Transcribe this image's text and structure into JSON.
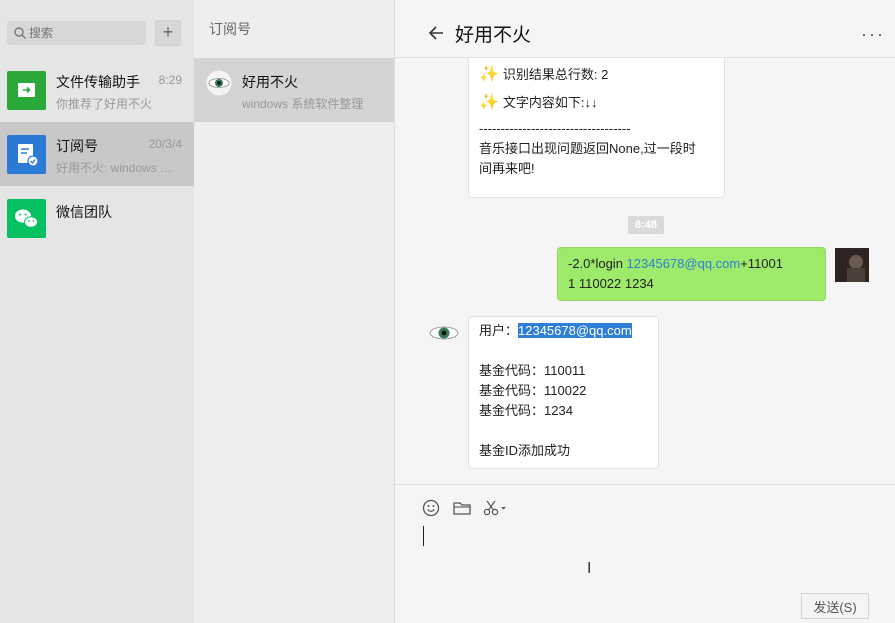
{
  "window": {
    "pin": "푸",
    "minimize": "—",
    "maximize": "☐",
    "close": "✕"
  },
  "sidebar": {
    "search_placeholder": "搜索",
    "add_label": "+",
    "conversations": [
      {
        "name": "文件传输助手",
        "time": "8:29",
        "last": "你推荐了好用不火",
        "color": "#2aa839"
      },
      {
        "name": "订阅号",
        "time": "20/3/4",
        "last": "好用不火: windows 系统软件整理",
        "color": "#2b7bd6"
      },
      {
        "name": "微信团队",
        "time": "",
        "last": "",
        "color": "#07c160"
      }
    ]
  },
  "middle": {
    "title": "订阅号",
    "account": {
      "name": "好用不火",
      "last": "windows 系统软件整理"
    }
  },
  "chat": {
    "title": "好用不火",
    "more": "···",
    "msg1": {
      "line1": "识别结果总行数: 2",
      "line2": "文字内容如下:↓↓",
      "divider": "-----------------------------------",
      "line3": "音乐接口出现问题返回None,过一段时",
      "line4": "间再来吧!"
    },
    "time": "8:48",
    "msg2": {
      "prefix": "-2.0*login ",
      "email": "12345678@qq.com",
      "suffix1": "+11001",
      "suffix2": "1 110022 1234"
    },
    "msg3": {
      "user_label": "用户：",
      "user_email": "12345678@qq.com",
      "fund1": "基金代码：110011",
      "fund2": "基金代码：110022",
      "fund3": "基金代码：1234",
      "result": "基金ID添加成功"
    },
    "send_label": "发送(S)"
  }
}
